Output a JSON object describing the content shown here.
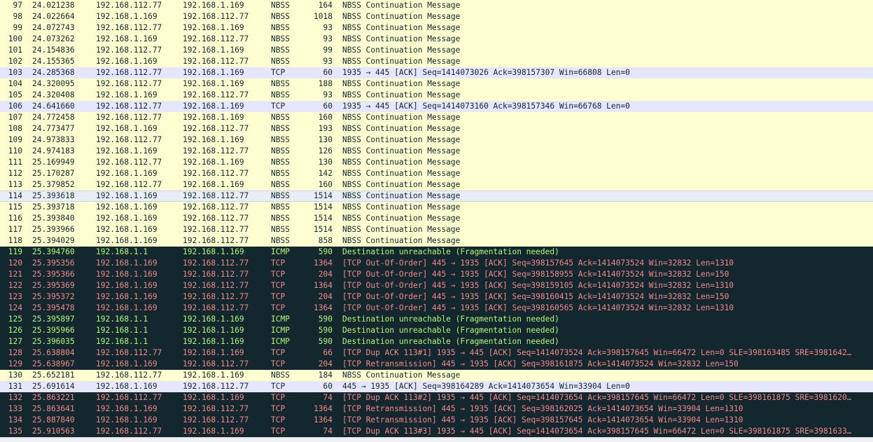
{
  "packets": [
    {
      "no": "97",
      "time": "24.021238",
      "src": "192.168.112.77",
      "dst": "192.168.1.169",
      "proto": "NBSS",
      "len": "164",
      "info": "NBSS Continuation Message",
      "type": "nbss"
    },
    {
      "no": "98",
      "time": "24.022664",
      "src": "192.168.1.169",
      "dst": "192.168.112.77",
      "proto": "NBSS",
      "len": "1018",
      "info": "NBSS Continuation Message",
      "type": "nbss"
    },
    {
      "no": "99",
      "time": "24.072743",
      "src": "192.168.112.77",
      "dst": "192.168.1.169",
      "proto": "NBSS",
      "len": "93",
      "info": "NBSS Continuation Message",
      "type": "nbss"
    },
    {
      "no": "100",
      "time": "24.073262",
      "src": "192.168.1.169",
      "dst": "192.168.112.77",
      "proto": "NBSS",
      "len": "93",
      "info": "NBSS Continuation Message",
      "type": "nbss"
    },
    {
      "no": "101",
      "time": "24.154836",
      "src": "192.168.112.77",
      "dst": "192.168.1.169",
      "proto": "NBSS",
      "len": "99",
      "info": "NBSS Continuation Message",
      "type": "nbss"
    },
    {
      "no": "102",
      "time": "24.155365",
      "src": "192.168.1.169",
      "dst": "192.168.112.77",
      "proto": "NBSS",
      "len": "93",
      "info": "NBSS Continuation Message",
      "type": "nbss"
    },
    {
      "no": "103",
      "time": "24.285368",
      "src": "192.168.112.77",
      "dst": "192.168.1.169",
      "proto": "TCP",
      "len": "60",
      "info": "1935 → 445 [ACK] Seq=1414073026 Ack=398157307 Win=66808 Len=0",
      "type": "tcp"
    },
    {
      "no": "104",
      "time": "24.320095",
      "src": "192.168.112.77",
      "dst": "192.168.1.169",
      "proto": "NBSS",
      "len": "188",
      "info": "NBSS Continuation Message",
      "type": "nbss"
    },
    {
      "no": "105",
      "time": "24.320408",
      "src": "192.168.1.169",
      "dst": "192.168.112.77",
      "proto": "NBSS",
      "len": "93",
      "info": "NBSS Continuation Message",
      "type": "nbss"
    },
    {
      "no": "106",
      "time": "24.641660",
      "src": "192.168.112.77",
      "dst": "192.168.1.169",
      "proto": "TCP",
      "len": "60",
      "info": "1935 → 445 [ACK] Seq=1414073160 Ack=398157346 Win=66768 Len=0",
      "type": "tcp"
    },
    {
      "no": "107",
      "time": "24.772458",
      "src": "192.168.112.77",
      "dst": "192.168.1.169",
      "proto": "NBSS",
      "len": "160",
      "info": "NBSS Continuation Message",
      "type": "nbss"
    },
    {
      "no": "108",
      "time": "24.773477",
      "src": "192.168.1.169",
      "dst": "192.168.112.77",
      "proto": "NBSS",
      "len": "193",
      "info": "NBSS Continuation Message",
      "type": "nbss"
    },
    {
      "no": "109",
      "time": "24.973833",
      "src": "192.168.112.77",
      "dst": "192.168.1.169",
      "proto": "NBSS",
      "len": "130",
      "info": "NBSS Continuation Message",
      "type": "nbss"
    },
    {
      "no": "110",
      "time": "24.974183",
      "src": "192.168.1.169",
      "dst": "192.168.112.77",
      "proto": "NBSS",
      "len": "126",
      "info": "NBSS Continuation Message",
      "type": "nbss"
    },
    {
      "no": "111",
      "time": "25.169949",
      "src": "192.168.112.77",
      "dst": "192.168.1.169",
      "proto": "NBSS",
      "len": "130",
      "info": "NBSS Continuation Message",
      "type": "nbss"
    },
    {
      "no": "112",
      "time": "25.170287",
      "src": "192.168.1.169",
      "dst": "192.168.112.77",
      "proto": "NBSS",
      "len": "142",
      "info": "NBSS Continuation Message",
      "type": "nbss"
    },
    {
      "no": "113",
      "time": "25.379852",
      "src": "192.168.112.77",
      "dst": "192.168.1.169",
      "proto": "NBSS",
      "len": "160",
      "info": "NBSS Continuation Message",
      "type": "nbss"
    },
    {
      "no": "114",
      "time": "25.393618",
      "src": "192.168.1.169",
      "dst": "192.168.112.77",
      "proto": "NBSS",
      "len": "1514",
      "info": "NBSS Continuation Message",
      "type": "sel"
    },
    {
      "no": "115",
      "time": "25.393718",
      "src": "192.168.1.169",
      "dst": "192.168.112.77",
      "proto": "NBSS",
      "len": "1514",
      "info": "NBSS Continuation Message",
      "type": "nbss"
    },
    {
      "no": "116",
      "time": "25.393840",
      "src": "192.168.1.169",
      "dst": "192.168.112.77",
      "proto": "NBSS",
      "len": "1514",
      "info": "NBSS Continuation Message",
      "type": "nbss"
    },
    {
      "no": "117",
      "time": "25.393966",
      "src": "192.168.1.169",
      "dst": "192.168.112.77",
      "proto": "NBSS",
      "len": "1514",
      "info": "NBSS Continuation Message",
      "type": "nbss"
    },
    {
      "no": "118",
      "time": "25.394029",
      "src": "192.168.1.169",
      "dst": "192.168.112.77",
      "proto": "NBSS",
      "len": "858",
      "info": "NBSS Continuation Message",
      "type": "nbss"
    },
    {
      "no": "119",
      "time": "25.394760",
      "src": "192.168.1.1",
      "dst": "192.168.1.169",
      "proto": "ICMP",
      "len": "590",
      "info": "Destination unreachable (Fragmentation needed)",
      "type": "icmp"
    },
    {
      "no": "120",
      "time": "25.395356",
      "src": "192.168.1.169",
      "dst": "192.168.112.77",
      "proto": "TCP",
      "len": "1364",
      "info": "[TCP Out-Of-Order] 445 → 1935 [ACK] Seq=398157645 Ack=1414073524 Win=32832 Len=1310",
      "type": "bad"
    },
    {
      "no": "121",
      "time": "25.395366",
      "src": "192.168.1.169",
      "dst": "192.168.112.77",
      "proto": "TCP",
      "len": "204",
      "info": "[TCP Out-Of-Order] 445 → 1935 [ACK] Seq=398158955 Ack=1414073524 Win=32832 Len=150",
      "type": "bad"
    },
    {
      "no": "122",
      "time": "25.395369",
      "src": "192.168.1.169",
      "dst": "192.168.112.77",
      "proto": "TCP",
      "len": "1364",
      "info": "[TCP Out-Of-Order] 445 → 1935 [ACK] Seq=398159105 Ack=1414073524 Win=32832 Len=1310",
      "type": "bad"
    },
    {
      "no": "123",
      "time": "25.395372",
      "src": "192.168.1.169",
      "dst": "192.168.112.77",
      "proto": "TCP",
      "len": "204",
      "info": "[TCP Out-Of-Order] 445 → 1935 [ACK] Seq=398160415 Ack=1414073524 Win=32832 Len=150",
      "type": "bad"
    },
    {
      "no": "124",
      "time": "25.395478",
      "src": "192.168.1.169",
      "dst": "192.168.112.77",
      "proto": "TCP",
      "len": "1364",
      "info": "[TCP Out-Of-Order] 445 → 1935 [ACK] Seq=398160565 Ack=1414073524 Win=32832 Len=1310",
      "type": "bad"
    },
    {
      "no": "125",
      "time": "25.395897",
      "src": "192.168.1.1",
      "dst": "192.168.1.169",
      "proto": "ICMP",
      "len": "590",
      "info": "Destination unreachable (Fragmentation needed)",
      "type": "icmp"
    },
    {
      "no": "126",
      "time": "25.395966",
      "src": "192.168.1.1",
      "dst": "192.168.1.169",
      "proto": "ICMP",
      "len": "590",
      "info": "Destination unreachable (Fragmentation needed)",
      "type": "icmp"
    },
    {
      "no": "127",
      "time": "25.396035",
      "src": "192.168.1.1",
      "dst": "192.168.1.169",
      "proto": "ICMP",
      "len": "590",
      "info": "Destination unreachable (Fragmentation needed)",
      "type": "icmp"
    },
    {
      "no": "128",
      "time": "25.638804",
      "src": "192.168.112.77",
      "dst": "192.168.1.169",
      "proto": "TCP",
      "len": "66",
      "info": "[TCP Dup ACK 113#1] 1935 → 445 [ACK] Seq=1414073524 Ack=398157645 Win=66472 Len=0 SLE=398163485 SRE=3981642…",
      "type": "bad"
    },
    {
      "no": "129",
      "time": "25.638967",
      "src": "192.168.1.169",
      "dst": "192.168.112.77",
      "proto": "TCP",
      "len": "204",
      "info": "[TCP Retransmission] 445 → 1935 [ACK] Seq=398161875 Ack=1414073524 Win=32832 Len=150",
      "type": "bad"
    },
    {
      "no": "130",
      "time": "25.652181",
      "src": "192.168.112.77",
      "dst": "192.168.1.169",
      "proto": "NBSS",
      "len": "184",
      "info": "NBSS Continuation Message",
      "type": "nbss"
    },
    {
      "no": "131",
      "time": "25.691614",
      "src": "192.168.1.169",
      "dst": "192.168.112.77",
      "proto": "TCP",
      "len": "60",
      "info": "445 → 1935 [ACK] Seq=398164289 Ack=1414073654 Win=33904 Len=0",
      "type": "tcp"
    },
    {
      "no": "132",
      "time": "25.863221",
      "src": "192.168.112.77",
      "dst": "192.168.1.169",
      "proto": "TCP",
      "len": "74",
      "info": "[TCP Dup ACK 113#2] 1935 → 445 [ACK] Seq=1414073654 Ack=398157645 Win=66472 Len=0 SLE=398161875 SRE=3981620…",
      "type": "bad"
    },
    {
      "no": "133",
      "time": "25.863641",
      "src": "192.168.1.169",
      "dst": "192.168.112.77",
      "proto": "TCP",
      "len": "1364",
      "info": "[TCP Retransmission] 445 → 1935 [ACK] Seq=398162025 Ack=1414073654 Win=33904 Len=1310",
      "type": "bad"
    },
    {
      "no": "134",
      "time": "25.887840",
      "src": "192.168.1.169",
      "dst": "192.168.112.77",
      "proto": "TCP",
      "len": "1364",
      "info": "[TCP Retransmission] 445 → 1935 [ACK] Seq=398157645 Ack=1414073654 Win=33904 Len=1310",
      "type": "bad"
    },
    {
      "no": "135",
      "time": "25.910563",
      "src": "192.168.112.77",
      "dst": "192.168.1.169",
      "proto": "TCP",
      "len": "74",
      "info": "[TCP Dup ACK 113#3] 1935 → 445 [ACK] Seq=1414073654 Ack=398157645 Win=66472 Len=0 SLE=398161875 SRE=3981633…",
      "type": "bad"
    }
  ],
  "colors": {
    "nbss_bg": "#feffd0",
    "tcp_bg": "#e7e6ff",
    "dark_bg": "#12272e",
    "icmp_fg": "#b7f774",
    "error_fg": "#f78787",
    "selected_bg": "#e8eef6"
  }
}
